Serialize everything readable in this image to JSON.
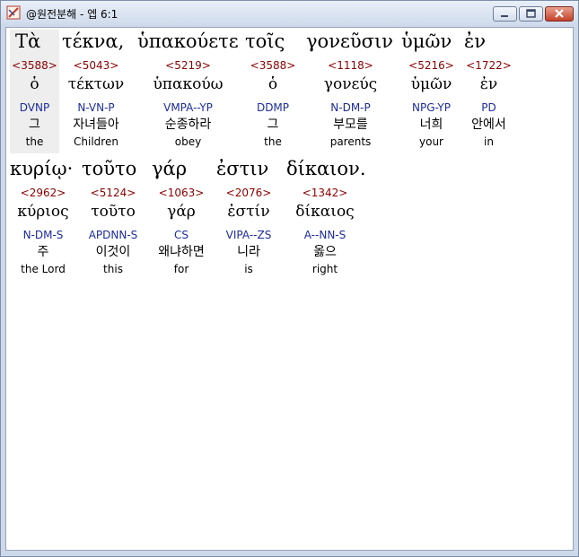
{
  "window": {
    "title": "@원전분해 - 엡 6:1",
    "buttons": {
      "minimize": "minimize",
      "maximize": "maximize",
      "close": "close"
    }
  },
  "verse_lines": [
    {
      "words": [
        {
          "greek": "Τὰ",
          "strong": "<3588>",
          "lemma": "ὁ",
          "parse": "DVNP",
          "korean": "그",
          "english": "the",
          "highlighted": true
        },
        {
          "greek": "τέκνα,",
          "strong": "<5043>",
          "lemma": "τέκτων",
          "parse": "N-VN-P",
          "korean": "자녀들아",
          "english": "Children"
        },
        {
          "greek": "ὑπακούετε",
          "strong": "<5219>",
          "lemma": "ὑπακούω",
          "parse": "VMPA--YP",
          "korean": "순종하라",
          "english": "obey"
        },
        {
          "greek": "τοῖς",
          "strong": "<3588>",
          "lemma": "ὁ",
          "parse": "DDMP",
          "korean": "그",
          "english": "the"
        },
        {
          "greek": "γονεῦσιν",
          "strong": "<1118>",
          "lemma": "γονεύς",
          "parse": "N-DM-P",
          "korean": "부모를",
          "english": "parents"
        },
        {
          "greek": "ὑμῶν",
          "strong": "<5216>",
          "lemma": "ὑμῶν",
          "parse": "NPG-YP",
          "korean": "너희",
          "english": "your"
        },
        {
          "greek": "ἐν",
          "strong": "<1722>",
          "lemma": "ἐν",
          "parse": "PD",
          "korean": "안에서",
          "english": "in"
        }
      ]
    },
    {
      "words": [
        {
          "greek": "κυρίῳ·",
          "strong": "<2962>",
          "lemma": "κύριος",
          "parse": "N-DM-S",
          "korean": "주",
          "english": "the Lord"
        },
        {
          "greek": "τοῦτο",
          "strong": "<5124>",
          "lemma": "τοῦτο",
          "parse": "APDNN-S",
          "korean": "이것이",
          "english": "this"
        },
        {
          "greek": "γάρ",
          "strong": "<1063>",
          "lemma": "γάρ",
          "parse": "CS",
          "korean": "왜냐하면",
          "english": "for"
        },
        {
          "greek": "ἐστιν",
          "strong": "<2076>",
          "lemma": "ἐστίν",
          "parse": "VIPA--ZS",
          "korean": "니라",
          "english": "is"
        },
        {
          "greek": "δίκαιον.",
          "strong": "<1342>",
          "lemma": "δίκαιος",
          "parse": "A--NN-S",
          "korean": "옳으",
          "english": "right"
        }
      ]
    }
  ],
  "colors": {
    "strong_number": "#8b0000",
    "parsing_code": "#1c2c9c",
    "highlight_bg": "#eeeeee"
  }
}
